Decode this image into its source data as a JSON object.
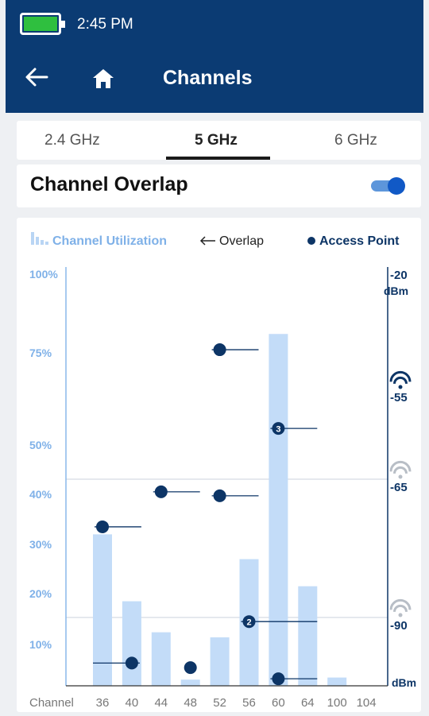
{
  "status_bar": {
    "time": "2:45 PM",
    "battery_icon": "battery-full-icon"
  },
  "app_bar": {
    "title": "Channels",
    "back_icon": "arrow-left-icon",
    "home_icon": "home-icon"
  },
  "tabs": [
    {
      "label": "2.4 GHz",
      "active": false
    },
    {
      "label": "5 GHz",
      "active": true
    },
    {
      "label": "6 GHz",
      "active": false
    }
  ],
  "overlap": {
    "title": "Channel Overlap",
    "toggle_on": true
  },
  "legend": {
    "utilization": "Channel Utilization",
    "overlap": "Overlap",
    "access_point": "Access Point"
  },
  "colors": {
    "header": "#0b3b73",
    "bar": "#c3dcf8",
    "utilization_axis": "#8ab8ea",
    "ap_dot": "#0d3566",
    "signal_axis": "#0d3566",
    "toggle": "#1159c6"
  },
  "chart_data": {
    "type": "bar",
    "xlabel": "Channel",
    "categories": [
      "36",
      "40",
      "44",
      "48",
      "52",
      "56",
      "60",
      "64",
      "100",
      "104"
    ],
    "series": [
      {
        "name": "Channel Utilization",
        "values": [
          32,
          18.5,
          12.4,
          1.5,
          11.4,
          27,
          81,
          21.5,
          2,
          0
        ]
      }
    ],
    "left_axis": {
      "ticks": [
        "100%",
        "75%",
        "50%",
        "40%",
        "30%",
        "20%",
        "10%"
      ],
      "range": [
        0,
        100
      ]
    },
    "right_axis": {
      "top_label": "-20",
      "top_unit": "dBm",
      "bottom_unit": "dBm",
      "ticks": [
        "-55",
        "-65",
        "-90"
      ]
    },
    "access_points": [
      {
        "channel": "36",
        "overlap_to": "40",
        "utilization": 33.5,
        "label": ""
      },
      {
        "channel": "40",
        "overlap_to": "36",
        "utilization": 5.5,
        "label": ""
      },
      {
        "channel": "44",
        "overlap_to": "48",
        "utilization": 40.5,
        "label": ""
      },
      {
        "channel": "48",
        "overlap_to": "",
        "utilization": 4.4,
        "label": ""
      },
      {
        "channel": "52",
        "overlap_to": "56",
        "utilization": 76,
        "label": ""
      },
      {
        "channel": "52",
        "overlap_to": "56",
        "utilization": 39.7,
        "label": ""
      },
      {
        "channel": "56",
        "overlap_to": "64",
        "utilization": 14.5,
        "label": "2"
      },
      {
        "channel": "60",
        "overlap_to": "64",
        "utilization": 54.5,
        "label": "3"
      },
      {
        "channel": "60",
        "overlap_to": "64",
        "utilization": 1.7,
        "label": ""
      }
    ],
    "threshold_lines": [
      {
        "signal": "-65"
      },
      {
        "signal": "-90"
      }
    ]
  }
}
